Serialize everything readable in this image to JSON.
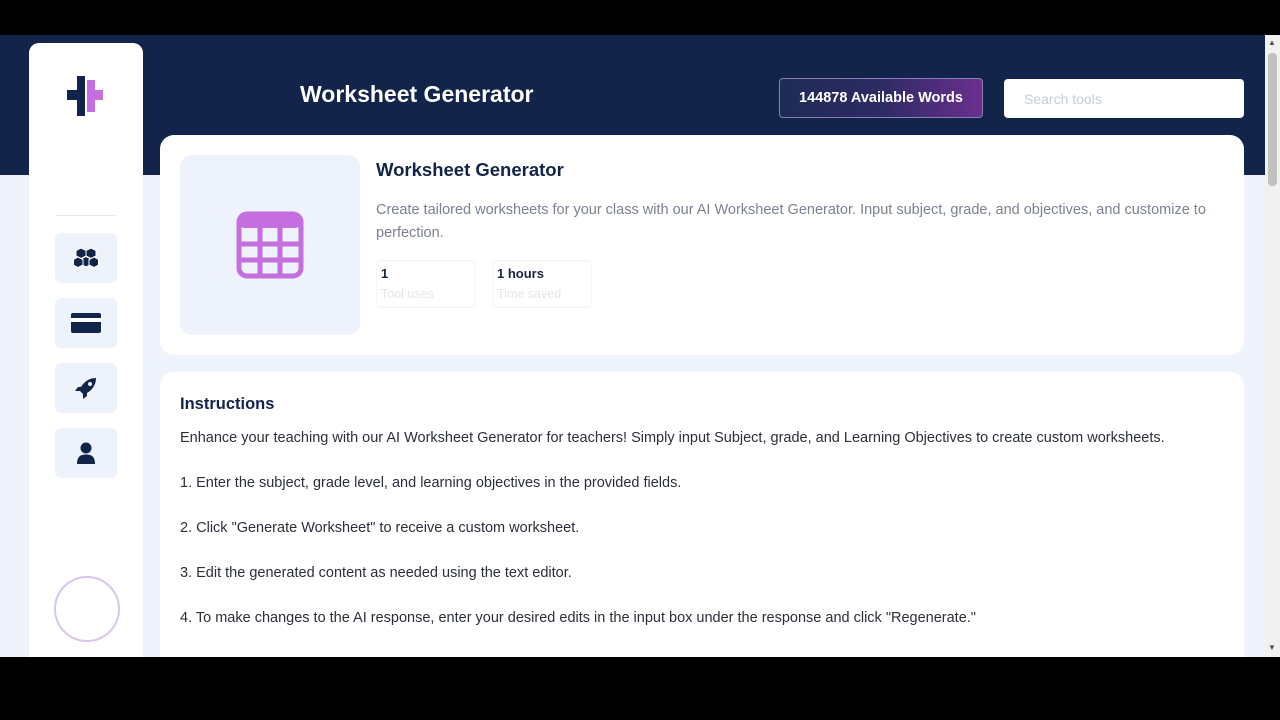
{
  "header": {
    "title": "Worksheet Generator",
    "words_badge": "144878 Available Words",
    "search_placeholder": "Search tools"
  },
  "sidebar": {
    "logo": "brand-logo",
    "items": [
      {
        "icon": "cubes-icon"
      },
      {
        "icon": "credit-card-icon"
      },
      {
        "icon": "rocket-icon"
      },
      {
        "icon": "user-icon"
      }
    ]
  },
  "tool": {
    "title": "Worksheet Generator",
    "icon": "table-calculator-icon",
    "description": "Create tailored worksheets for your class with our AI Worksheet Generator. Input subject, grade, and objectives, and customize to perfection.",
    "stats": [
      {
        "value": "1",
        "label": "Tool uses"
      },
      {
        "value": "1 hours",
        "label": "Time saved"
      }
    ]
  },
  "instructions": {
    "title": "Instructions",
    "intro": "Enhance your teaching with our AI Worksheet Generator for teachers! Simply input Subject, grade, and Learning Objectives to create custom worksheets.",
    "steps": [
      "1. Enter the subject, grade level, and learning objectives in the provided fields.",
      "2. Click \"Generate Worksheet\" to receive a custom worksheet.",
      "3. Edit the generated content as needed using the text editor.",
      "4. To make changes to the AI response, enter your desired edits in the input box under the response and click \"Regenerate.\""
    ]
  },
  "colors": {
    "navy": "#12244a",
    "accent_purple": "#c56ee0",
    "page_bg": "#eef3fc"
  }
}
